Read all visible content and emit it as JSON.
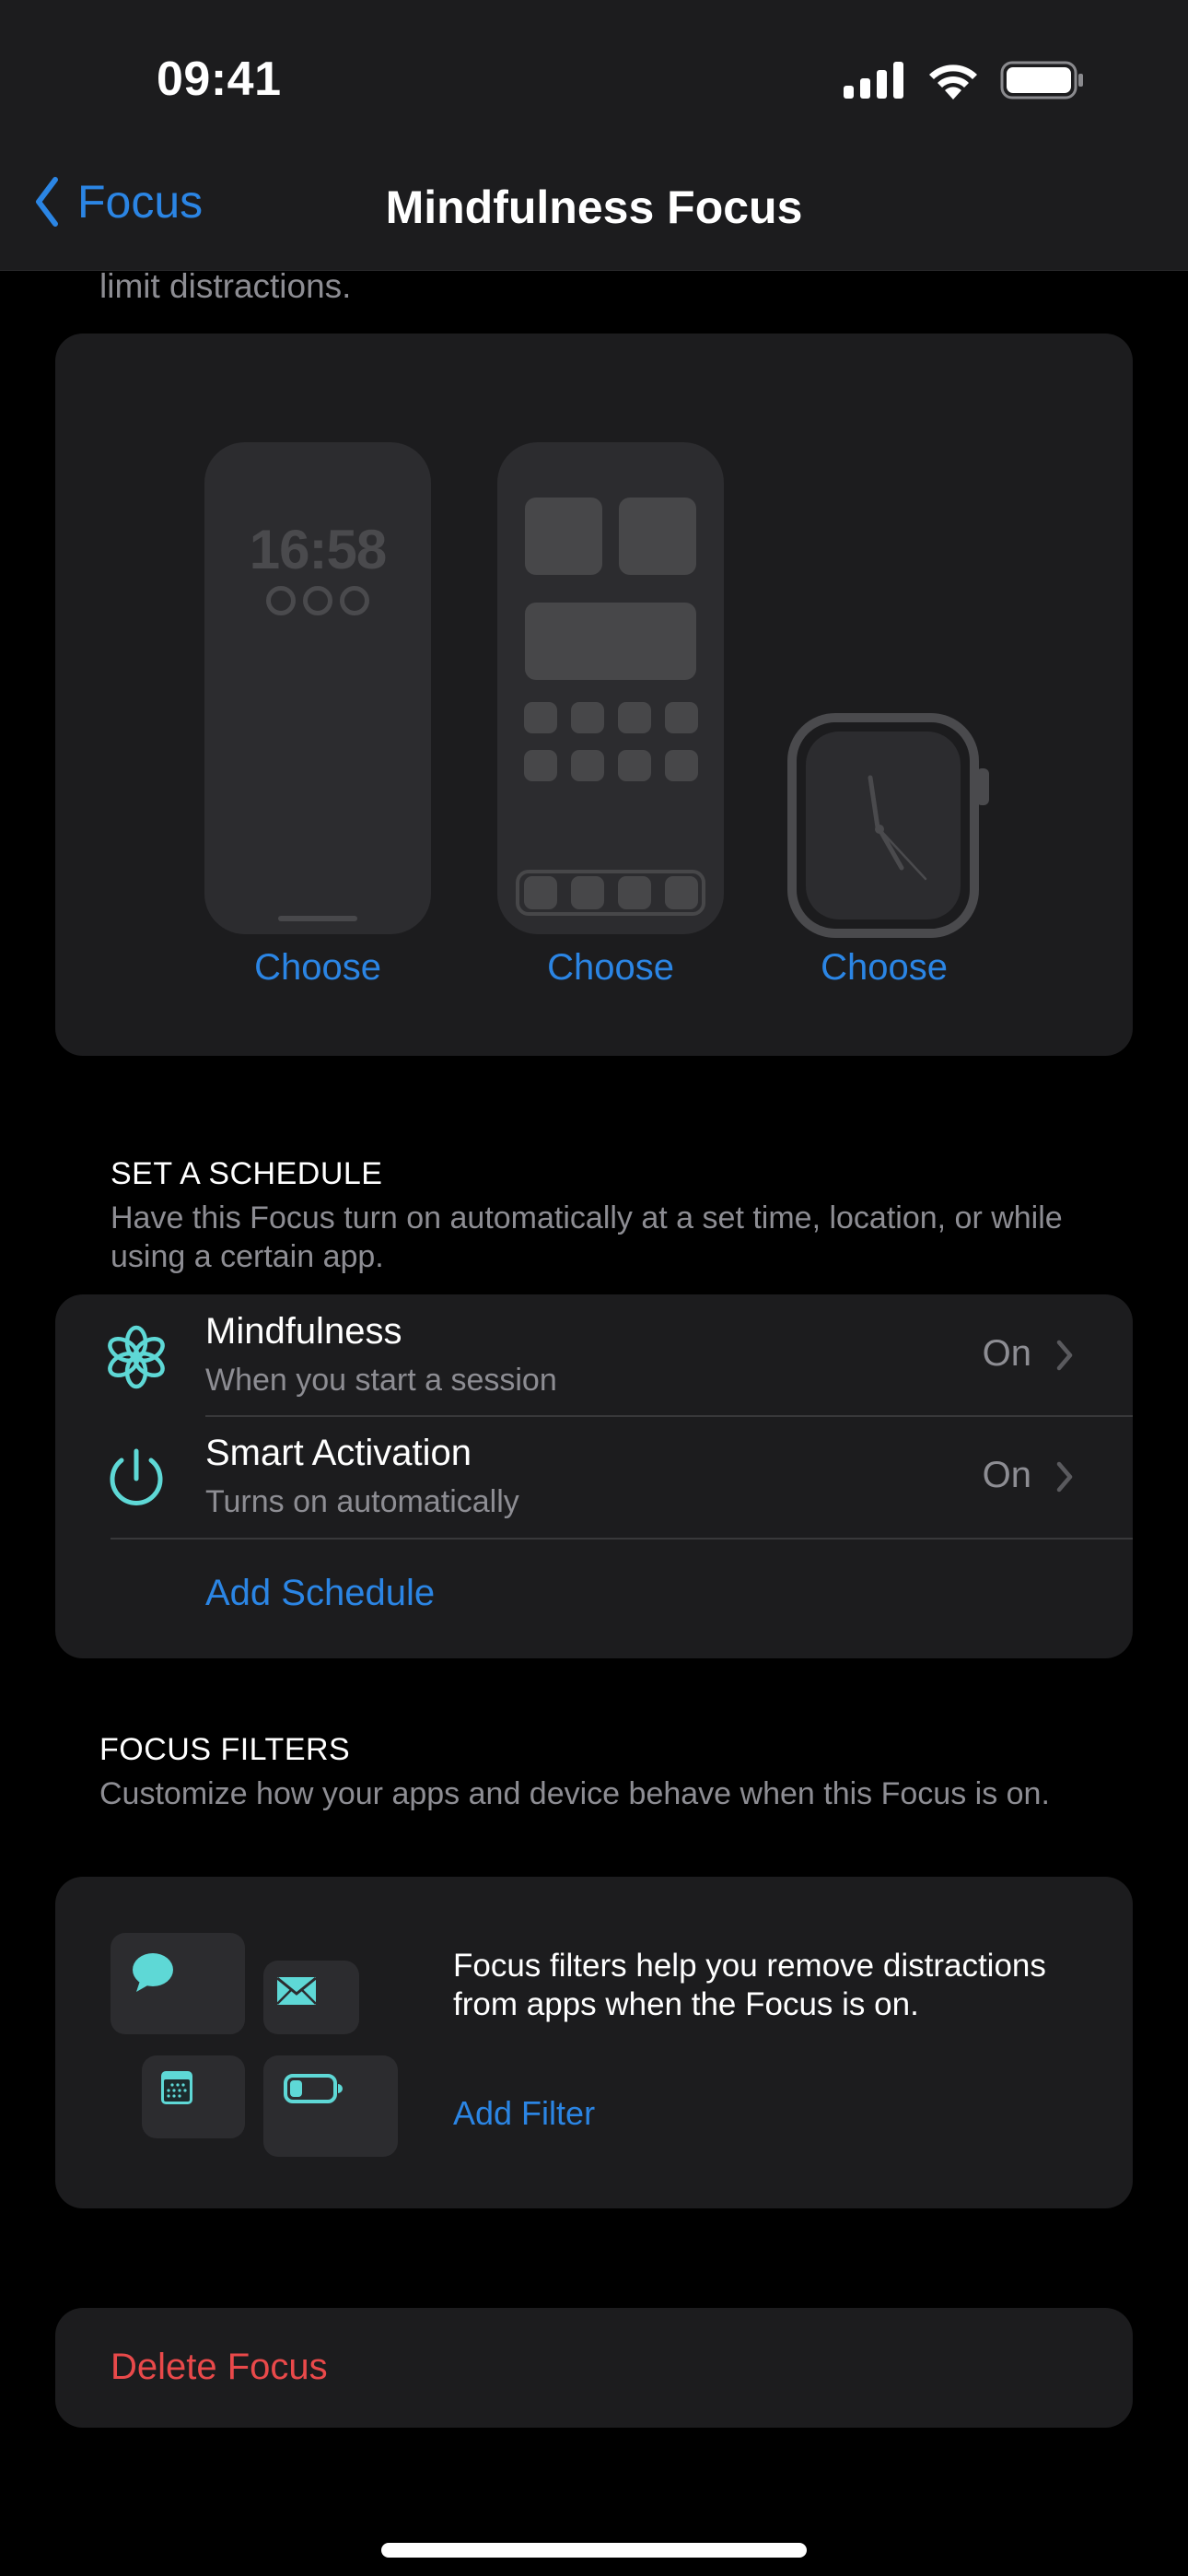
{
  "status_bar": {
    "time": "09:41",
    "icons": [
      "cellular-signal-icon",
      "wifi-icon",
      "battery-icon"
    ]
  },
  "nav": {
    "back_label": "Focus",
    "back_icon": "chevron-left-icon",
    "title": "Mindfulness Focus"
  },
  "intro": {
    "tail_text": "limit distractions."
  },
  "customize_screens": {
    "lock_screen_time": "16:58",
    "choices": [
      {
        "device": "lock-screen",
        "label": "Choose"
      },
      {
        "device": "home-screen",
        "label": "Choose"
      },
      {
        "device": "watch-face",
        "label": "Choose"
      }
    ]
  },
  "schedule": {
    "title": "SET A SCHEDULE",
    "description": "Have this Focus turn on automatically at a set time, location, or while using a certain app.",
    "items": [
      {
        "icon": "mindfulness-flower-icon",
        "title": "Mindfulness",
        "subtitle": "When you start a session",
        "value": "On"
      },
      {
        "icon": "power-icon",
        "title": "Smart Activation",
        "subtitle": "Turns on automatically",
        "value": "On"
      }
    ],
    "add_label": "Add Schedule"
  },
  "filters": {
    "title": "FOCUS FILTERS",
    "description": "Customize how your apps and device behave when this Focus is on.",
    "illustration_icons": [
      "messages-icon",
      "mail-icon",
      "calendar-icon",
      "battery-icon"
    ],
    "body": "Focus filters help you remove distractions from apps when the Focus is on.",
    "add_label": "Add Filter"
  },
  "delete": {
    "label": "Delete Focus"
  },
  "colors": {
    "accent": "#2b85e4",
    "teal": "#5ed8d6",
    "destructive": "#e9494a",
    "background": "#000000",
    "card": "#1c1c1e",
    "secondary_text": "#8d8d93"
  }
}
